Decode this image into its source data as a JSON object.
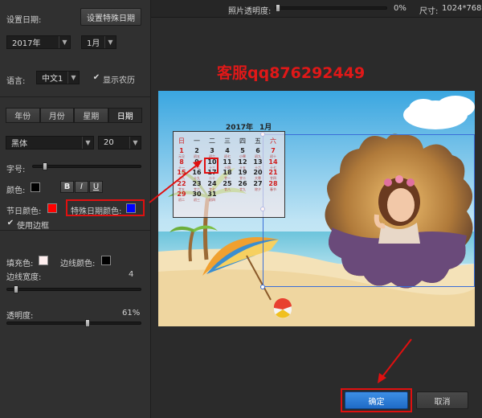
{
  "sidebar": {
    "set_date_label": "设置日期:",
    "special_date_button": "设置特殊日期",
    "year_select": "2017年",
    "month_select": "1月",
    "language_label": "语言:",
    "language_select": "中文1",
    "show_lunar_label": "显示农历",
    "tabs": [
      "年份",
      "月份",
      "星期",
      "日期"
    ],
    "font_select": "黑体",
    "font_size_select": "20",
    "font_size_label": "字号:",
    "color_label": "颜色:",
    "bold_label": "B",
    "italic_label": "I",
    "underline_label": "U",
    "holiday_color_label": "节日颜色:",
    "special_color_label": "特殊日期颜色:",
    "use_border_label": "使用边框",
    "fill_color_label": "填充色:",
    "border_color_label": "边线颜色:",
    "border_width_label": "边线宽度:",
    "border_width_value": "4",
    "opacity_label": "透明度:",
    "opacity_value": "61%"
  },
  "topbar": {
    "photo_opacity_label": "照片透明度:",
    "photo_opacity_value": "0%",
    "size_label": "尺寸:",
    "size_value": "1024*768"
  },
  "watermark": "客服qq876292449",
  "calendar": {
    "title_year": "2017年",
    "title_month": "1月",
    "weekdays": [
      "日",
      "一",
      "二",
      "三",
      "四",
      "五",
      "六"
    ],
    "rows": [
      [
        {
          "d": "1",
          "s": "元旦"
        },
        {
          "d": "2",
          "s": "初五"
        },
        {
          "d": "3",
          "s": "初六"
        },
        {
          "d": "4",
          "s": "初七"
        },
        {
          "d": "5",
          "s": "小寒"
        },
        {
          "d": "6",
          "s": "初九"
        },
        {
          "d": "7",
          "s": "初十"
        }
      ],
      [
        {
          "d": "8",
          "s": "十一"
        },
        {
          "d": "9",
          "s": "十二"
        },
        {
          "d": "10",
          "s": "十三"
        },
        {
          "d": "11",
          "s": "十四"
        },
        {
          "d": "12",
          "s": "十五"
        },
        {
          "d": "13",
          "s": "十六"
        },
        {
          "d": "14",
          "s": "十七"
        }
      ],
      [
        {
          "d": "15",
          "s": "十八"
        },
        {
          "d": "16",
          "s": "十九"
        },
        {
          "d": "17",
          "s": "二十"
        },
        {
          "d": "18",
          "s": "廿一"
        },
        {
          "d": "19",
          "s": "廿二"
        },
        {
          "d": "20",
          "s": "大寒"
        },
        {
          "d": "21",
          "s": "廿四"
        }
      ],
      [
        {
          "d": "22",
          "s": "廿五"
        },
        {
          "d": "23",
          "s": "廿六"
        },
        {
          "d": "24",
          "s": "廿七"
        },
        {
          "d": "25",
          "s": "廿八"
        },
        {
          "d": "26",
          "s": "廿九"
        },
        {
          "d": "27",
          "s": "除夕"
        },
        {
          "d": "28",
          "s": "春节"
        }
      ],
      [
        {
          "d": "29",
          "s": "初二"
        },
        {
          "d": "30",
          "s": "初三"
        },
        {
          "d": "31",
          "s": "初四"
        }
      ]
    ]
  },
  "footer": {
    "ok_button": "确定",
    "cancel_button": "取消"
  },
  "colors": {
    "holiday": "#ff0000",
    "special": "#0000ff",
    "text": "#000000",
    "fill": "#ffeeee",
    "border": "#000000",
    "highlight": "#e01010"
  }
}
